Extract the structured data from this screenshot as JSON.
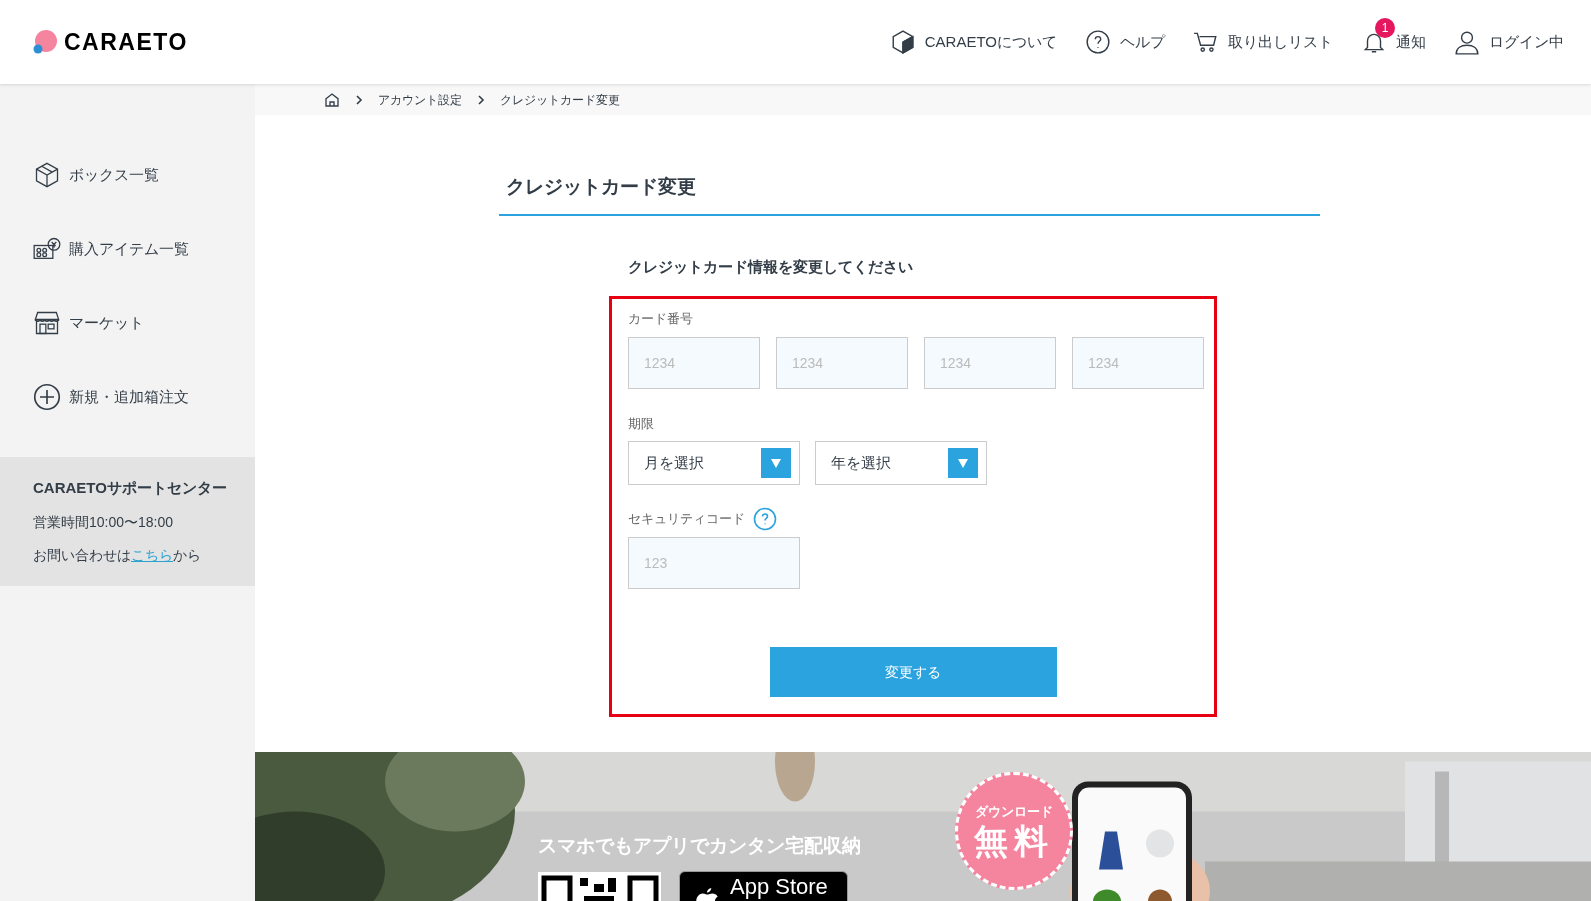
{
  "header": {
    "logo": "CARAETO",
    "nav": [
      {
        "kind": "about",
        "label": "CARAETOについて"
      },
      {
        "kind": "help",
        "label": "ヘルプ"
      },
      {
        "kind": "cart",
        "label": "取り出しリスト"
      },
      {
        "kind": "bell",
        "label": "通知",
        "badge": "1"
      },
      {
        "kind": "user",
        "label": "ログイン中"
      }
    ]
  },
  "breadcrumb": [
    "アカウント設定",
    "クレジットカード変更"
  ],
  "sidebar": {
    "items": [
      {
        "kind": "box",
        "label": "ボックス一覧"
      },
      {
        "kind": "items",
        "label": "購入アイテム一覧"
      },
      {
        "kind": "market",
        "label": "マーケット"
      },
      {
        "kind": "add",
        "label": "新規・追加箱注文"
      }
    ],
    "support": {
      "title": "CARAETOサポートセンター",
      "hours": "営業時間10:00〜18:00",
      "contact_before": "お問い合わせは",
      "contact_link": "こちら",
      "contact_after": "から"
    }
  },
  "form": {
    "title": "クレジットカード変更",
    "subtitle": "クレジットカード情報を変更してください",
    "card_number": {
      "label": "カード番号",
      "placeholders": [
        "1234",
        "1234",
        "1234",
        "1234"
      ]
    },
    "expiry": {
      "label": "期限",
      "selects": [
        "月を選択",
        "年を選択"
      ]
    },
    "security": {
      "label": "セキュリティコード",
      "placeholder": "123"
    },
    "submit": "変更する"
  },
  "banner": {
    "tagline": "スマホでもアプリでカンタン宅配収納",
    "app_store": "App Store",
    "badge_small": "ダウンロード",
    "badge_big": "無料"
  }
}
